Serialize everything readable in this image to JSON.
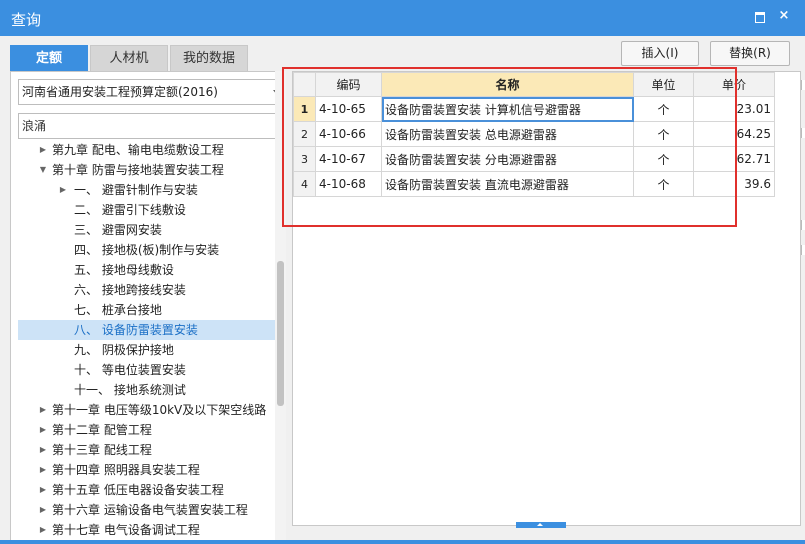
{
  "window": {
    "title": "查询",
    "minimize_icon": "restore-icon",
    "close_icon": "close-icon",
    "close_glyph": "×"
  },
  "tabs": [
    {
      "label": "定额",
      "active": true
    },
    {
      "label": "人材机",
      "active": false
    },
    {
      "label": "我的数据",
      "active": false
    }
  ],
  "left": {
    "dropdown_value": "河南省通用安装工程预算定额(2016)",
    "search_value": "浪涌",
    "tree": [
      {
        "label": "第九章  配电、输电电缆敷设工程",
        "caret": "▶",
        "indent": 0
      },
      {
        "label": "第十章  防雷与接地装置安装工程",
        "caret": "▼",
        "indent": 0
      },
      {
        "label": "一、  避雷针制作与安装",
        "caret": "▶",
        "indent": 1
      },
      {
        "label": "二、  避雷引下线敷设",
        "caret": "",
        "indent": 1
      },
      {
        "label": "三、  避雷网安装",
        "caret": "",
        "indent": 1
      },
      {
        "label": "四、  接地极(板)制作与安装",
        "caret": "",
        "indent": 1
      },
      {
        "label": "五、  接地母线敷设",
        "caret": "",
        "indent": 1
      },
      {
        "label": "六、  接地跨接线安装",
        "caret": "",
        "indent": 1
      },
      {
        "label": "七、  桩承台接地",
        "caret": "",
        "indent": 1
      },
      {
        "label": "八、  设备防雷装置安装",
        "caret": "",
        "indent": 1,
        "selected": true
      },
      {
        "label": "九、  阴极保护接地",
        "caret": "",
        "indent": 1
      },
      {
        "label": "十、  等电位装置安装",
        "caret": "",
        "indent": 1
      },
      {
        "label": "十一、  接地系统测试",
        "caret": "",
        "indent": 1
      },
      {
        "label": "第十一章  电压等级10kV及以下架空线路",
        "caret": "▶",
        "indent": 0
      },
      {
        "label": "第十二章  配管工程",
        "caret": "▶",
        "indent": 0
      },
      {
        "label": "第十三章  配线工程",
        "caret": "▶",
        "indent": 0
      },
      {
        "label": "第十四章  照明器具安装工程",
        "caret": "▶",
        "indent": 0
      },
      {
        "label": "第十五章  低压电器设备安装工程",
        "caret": "▶",
        "indent": 0
      },
      {
        "label": "第十六章  运输设备电气装置安装工程",
        "caret": "▶",
        "indent": 0
      },
      {
        "label": "第十七章  电气设备调试工程",
        "caret": "▶",
        "indent": 0
      }
    ]
  },
  "toolbar": {
    "insert_label": "插入(I)",
    "replace_label": "替换(R)"
  },
  "grid": {
    "headers": [
      "",
      "编码",
      "名称",
      "单位",
      "单价"
    ],
    "rows": [
      {
        "no": "1",
        "code": "4-10-65",
        "name": "设备防雷装置安装 计算机信号避雷器",
        "unit": "个",
        "price": "23.01"
      },
      {
        "no": "2",
        "code": "4-10-66",
        "name": "设备防雷装置安装 总电源避雷器",
        "unit": "个",
        "price": "64.25"
      },
      {
        "no": "3",
        "code": "4-10-67",
        "name": "设备防雷装置安装 分电源避雷器",
        "unit": "个",
        "price": "62.71"
      },
      {
        "no": "4",
        "code": "4-10-68",
        "name": "设备防雷装置安装 直流电源避雷器",
        "unit": "个",
        "price": "39.6"
      }
    ]
  },
  "colors": {
    "accent": "#3b8fe0",
    "highlight_box": "#e0302c",
    "header_highlight": "#fbe9b7",
    "selected_tree": "#cde3f7"
  }
}
